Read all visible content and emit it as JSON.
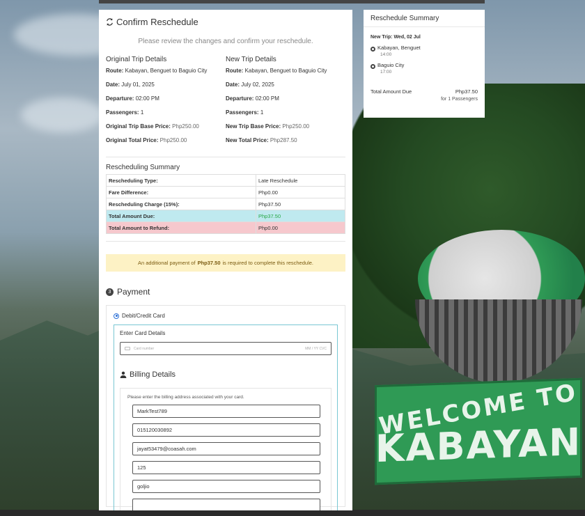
{
  "confirm": {
    "title": "Confirm Reschedule",
    "subtitle": "Please review the changes and confirm your reschedule."
  },
  "original": {
    "heading": "Original Trip Details",
    "route_label": "Route:",
    "route": "Kabayan, Benguet to Baguio City",
    "date_label": "Date:",
    "date": "July 01, 2025",
    "departure_label": "Departure:",
    "departure": "02:00 PM",
    "passengers_label": "Passengers:",
    "passengers": "1",
    "base_label": "Original Trip Base Price:",
    "base": "Php250.00",
    "total_label": "Original Total Price:",
    "total": "Php250.00"
  },
  "newtrip": {
    "heading": "New Trip Details",
    "route_label": "Route:",
    "route": "Kabayan, Benguet to Baguio City",
    "date_label": "Date:",
    "date": "July 02, 2025",
    "departure_label": "Departure:",
    "departure": "02:00 PM",
    "passengers_label": "Passengers:",
    "passengers": "1",
    "base_label": "New Trip Base Price:",
    "base": "Php250.00",
    "total_label": "New Total Price:",
    "total": "Php287.50"
  },
  "summary": {
    "heading": "Rescheduling Summary",
    "rows": [
      {
        "label": "Rescheduling Type:",
        "value": "Late Reschedule"
      },
      {
        "label": "Fare Difference:",
        "value": "Php0.00"
      },
      {
        "label": "Rescheduling Charge (15%):",
        "value": "Php37.50"
      },
      {
        "label": "Total Amount Due:",
        "value": "Php37.50"
      },
      {
        "label": "Total Amount to Refund:",
        "value": "Php0.00"
      }
    ]
  },
  "alert": {
    "prefix": "An additional payment of",
    "amount": "Php37.50",
    "suffix": "is required to complete this reschedule."
  },
  "payment": {
    "step": "3",
    "title": "Payment",
    "method_label": "Debit/Credit Card",
    "card_title": "Enter Card Details",
    "card_placeholder": "Card number",
    "card_expiry_cvc": "MM / YY  CVC",
    "billing_title": "Billing Details",
    "billing_note": "Please enter the billing address associated with your card.",
    "fields": [
      "MarkTest789",
      "015120030892",
      "jayat53479@coasah.com",
      "125",
      "goljio"
    ]
  },
  "side": {
    "title": "Reschedule Summary",
    "new_trip": "New Trip: Wed, 02 Jul",
    "stops": [
      {
        "place": "Kabayan, Benguet",
        "time": "14:00"
      },
      {
        "place": "Baguio City",
        "time": "17:00"
      }
    ],
    "total_label": "Total Amount Due",
    "total_amount": "Php37.50",
    "total_sub": "for 1 Passengers"
  },
  "background": {
    "sign_line1": "WELCOME TO",
    "sign_line2": "KABAYAN"
  },
  "colors": {
    "due_bg": "#bfe9ef",
    "refund_bg": "#f6c8cd",
    "alert_bg": "#fdf2c5",
    "due_text": "#28a745"
  }
}
